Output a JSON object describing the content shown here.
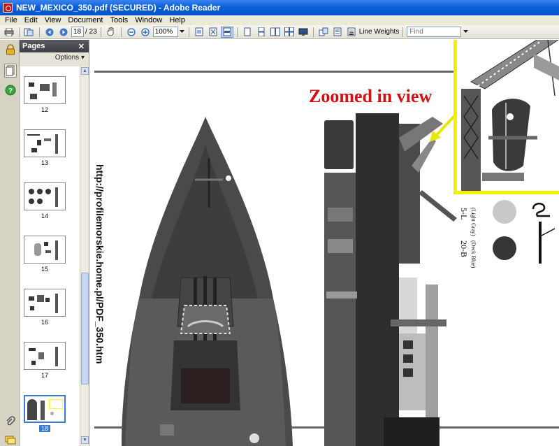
{
  "window": {
    "title": "NEW_MEXICO_350.pdf (SECURED) - Adobe Reader"
  },
  "menu": [
    "File",
    "Edit",
    "View",
    "Document",
    "Tools",
    "Window",
    "Help"
  ],
  "toolbar": {
    "page_current": "18",
    "page_total": "/ 23",
    "zoom": "100%",
    "line_weights_label": "Line Weights",
    "find_placeholder": "Find"
  },
  "pages_panel": {
    "title": "Pages",
    "options_label": "Options",
    "thumbnails": [
      {
        "label": "12"
      },
      {
        "label": "13"
      },
      {
        "label": "14"
      },
      {
        "label": "15"
      },
      {
        "label": "16"
      },
      {
        "label": "17"
      },
      {
        "label": "18",
        "selected": true
      }
    ]
  },
  "document": {
    "url_text": "http://profilemorskie.home.pl/PDF_350.htm",
    "callout": "Zoomed in view",
    "swatches": [
      {
        "code": "5-L",
        "name": "(Light Gray)",
        "color": "#c8c8c8"
      },
      {
        "code": "20-B",
        "name": "(Deck Blue)",
        "color": "#363636"
      }
    ]
  },
  "colors": {
    "accent_title": "#0a5fd9",
    "callout_red": "#d01212",
    "inset_border": "#f0f000"
  }
}
